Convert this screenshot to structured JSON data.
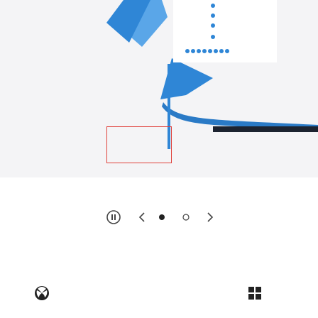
{
  "colors": {
    "background": "#ffffff",
    "hero_background": "#f4f4f6",
    "accent_blue": "#2f86d6",
    "selection_red": "#e0413b",
    "icon_dark": "#444444"
  },
  "hero": {
    "artwork": "product-photo-blue-cards",
    "selection_frame": "empty-red-frame"
  },
  "carousel": {
    "slide_count": 2,
    "active_slide": 1,
    "controls": [
      "pause-icon",
      "chevron-left-icon",
      "dot-filled",
      "dot-empty",
      "chevron-right-icon"
    ]
  },
  "footer": {
    "left_icon": "xbox-icon",
    "right_icon": "windows-icon"
  }
}
